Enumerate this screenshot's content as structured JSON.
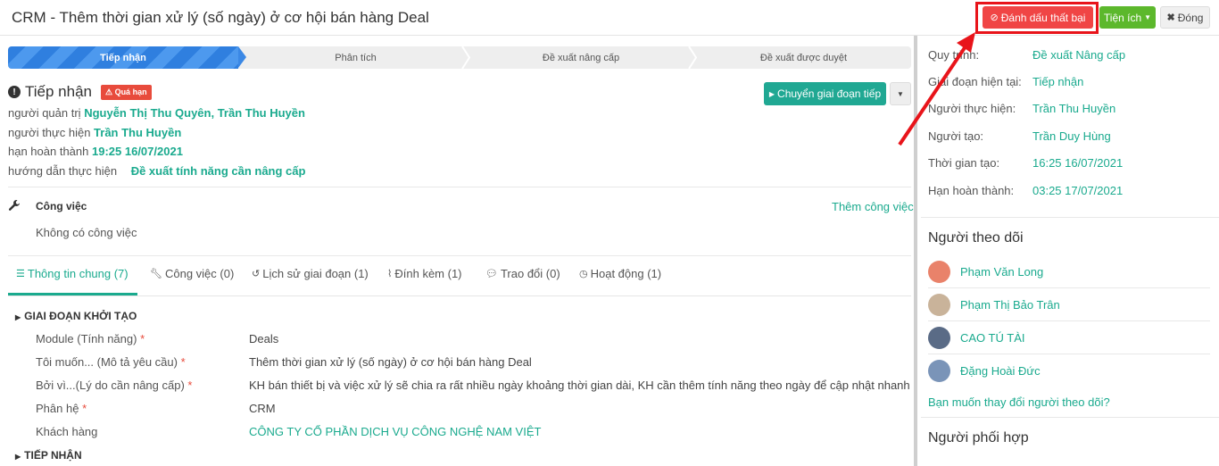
{
  "header": {
    "title": "CRM - Thêm thời gian xử lý (số ngày) ở cơ hội bán hàng Deal",
    "mark_failed": "Đánh dấu thất bại",
    "utilities": "Tiện ích",
    "close": "Đóng"
  },
  "stages": [
    "Tiếp nhận",
    "Phân tích",
    "Đề xuất nâng cấp",
    "Đề xuất được duyệt"
  ],
  "current": {
    "title": "Tiếp nhận",
    "badge": "Quá hạn",
    "next_stage_button": "Chuyển giai đoạn tiếp",
    "manager_label": "người quản trị",
    "manager_value": "Nguyễn Thị Thu Quyên, Trần Thu Huyền",
    "assignee_label": "người thực hiện",
    "assignee_value": "Trần Thu Huyền",
    "deadline_label": "hạn hoàn thành",
    "deadline_value": "19:25 16/07/2021",
    "guide_label": "hướng dẫn thực hiện",
    "guide_value": "Đề xuất tính năng cần nâng cấp"
  },
  "tasks": {
    "title": "Công việc",
    "add": "Thêm công việc",
    "empty": "Không có công việc"
  },
  "tabs": [
    {
      "label": "Thông tin chung (7)"
    },
    {
      "label": "Công việc (0)"
    },
    {
      "label": "Lịch sử giai đoạn (1)"
    },
    {
      "label": "Đính kèm (1)"
    },
    {
      "label": "Trao đổi (0)"
    },
    {
      "label": "Hoạt động (1)"
    }
  ],
  "groups": {
    "init": "GIAI ĐOẠN KHỞI TẠO",
    "receive": "TIẾP NHẬN"
  },
  "fields": [
    {
      "label": "Module (Tính năng)",
      "value": "Deals"
    },
    {
      "label": "Tôi muốn... (Mô tả yêu cầu)",
      "value": "Thêm thời gian xử lý (số ngày) ở cơ hội bán hàng Deal"
    },
    {
      "label": "Bởi vì...(Lý do cần nâng cấp)",
      "value": "KH bán thiết bị và việc xử lý sẽ chia ra rất nhiều ngày khoảng thời gian dài, KH cần thêm tính năng theo ngày để cập nhật nhanh"
    },
    {
      "label": "Phân hệ",
      "value": "CRM"
    },
    {
      "label": "Khách hàng",
      "value": "CÔNG TY CỔ PHẦN DỊCH VỤ CÔNG NGHỆ NAM VIỆT"
    }
  ],
  "details": [
    {
      "label": "Quy trình:",
      "value": "Đề xuất Nâng cấp"
    },
    {
      "label": "Giai đoạn hiện tại:",
      "value": "Tiếp nhận"
    },
    {
      "label": "Người thực hiện:",
      "value": "Trần Thu Huyền"
    },
    {
      "label": "Người tạo:",
      "value": "Trần Duy Hùng"
    },
    {
      "label": "Thời gian tạo:",
      "value": "16:25 16/07/2021"
    },
    {
      "label": "Hạn hoàn thành:",
      "value": "03:25 17/07/2021"
    }
  ],
  "followers": {
    "title": "Người theo dõi",
    "people": [
      {
        "name": "Phạm Văn Long",
        "avatar_color": "#e9826a"
      },
      {
        "name": "Phạm Thị Bảo Trân",
        "avatar_color": "#c9b39a"
      },
      {
        "name": "CAO TÚ TÀI",
        "avatar_color": "#5a6b86"
      },
      {
        "name": "Đặng Hoài Đức",
        "avatar_color": "#7a94b8"
      }
    ],
    "change_link": "Bạn muốn thay đổi người theo dõi?"
  },
  "coordinators": {
    "title": "Người phối hợp"
  },
  "colors": {
    "accent": "#1aaa8e",
    "danger": "#f04545",
    "success": "#5cb82c",
    "stage_active": "#2f7fdf"
  }
}
